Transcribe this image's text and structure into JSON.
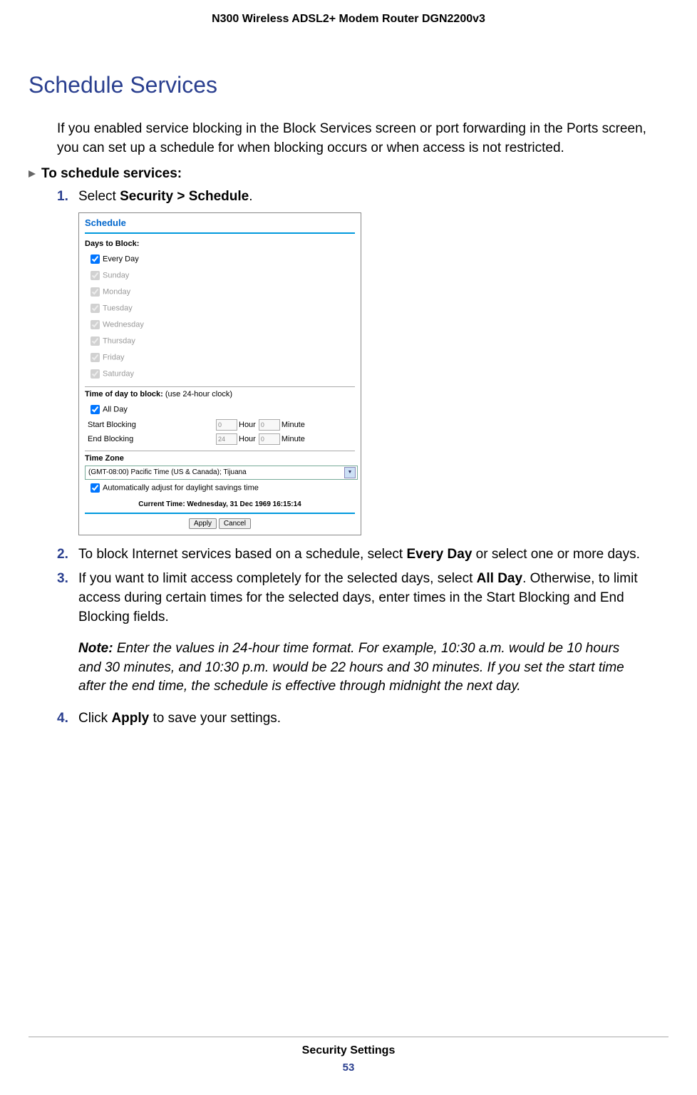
{
  "header": {
    "title": "N300 Wireless ADSL2+ Modem Router DGN2200v3"
  },
  "section": {
    "heading": "Schedule Services",
    "intro": "If you enabled service blocking in the Block Services screen or port forwarding in the Ports screen, you can set up a schedule for when blocking occurs or when access is not restricted.",
    "procedure_title": "To schedule services:"
  },
  "steps": {
    "s1_num": "1.",
    "s1_a": "Select ",
    "s1_b": "Security > Schedule",
    "s1_c": ".",
    "s2_num": "2.",
    "s2_a": "To block Internet services based on a schedule, select ",
    "s2_b": "Every Day",
    "s2_c": " or select one or more days.",
    "s3_num": "3.",
    "s3_a": "If you want to limit access completely for the selected days, select ",
    "s3_b": "All Day",
    "s3_c": ". Otherwise, to limit access during certain times for the selected days, enter times in the Start Blocking and End Blocking fields.",
    "s4_num": "4.",
    "s4_a": "Click ",
    "s4_b": "Apply",
    "s4_c": " to save your settings."
  },
  "note": {
    "label": "Note:  ",
    "text": "Enter the values in 24-hour time format. For example, 10:30 a.m. would be 10 hours and 30 minutes, and 10:30 p.m. would be 22 hours and 30 minutes. If you set the start time after the end time, the schedule is effective through midnight the next day."
  },
  "screenshot": {
    "title": "Schedule",
    "days_label": "Days to Block:",
    "every_day": "Every Day",
    "sunday": "Sunday",
    "monday": "Monday",
    "tuesday": "Tuesday",
    "wednesday": "Wednesday",
    "thursday": "Thursday",
    "friday": "Friday",
    "saturday": "Saturday",
    "time_label": "Time of day to block: ",
    "time_note": "(use 24-hour clock)",
    "all_day": "All Day",
    "start_blocking": "Start Blocking",
    "end_blocking": "End Blocking",
    "hour": "Hour",
    "minute": "Minute",
    "start_hour_val": "0",
    "start_min_val": "0",
    "end_hour_val": "24",
    "end_min_val": "0",
    "tz_label": "Time Zone",
    "tz_value": "(GMT-08:00) Pacific Time (US & Canada); Tijuana",
    "dst": "Automatically adjust for daylight savings time",
    "current_time": "Current Time: Wednesday, 31 Dec 1969 16:15:14",
    "apply": "Apply",
    "cancel": "Cancel"
  },
  "footer": {
    "chapter": "Security Settings",
    "page": "53"
  }
}
